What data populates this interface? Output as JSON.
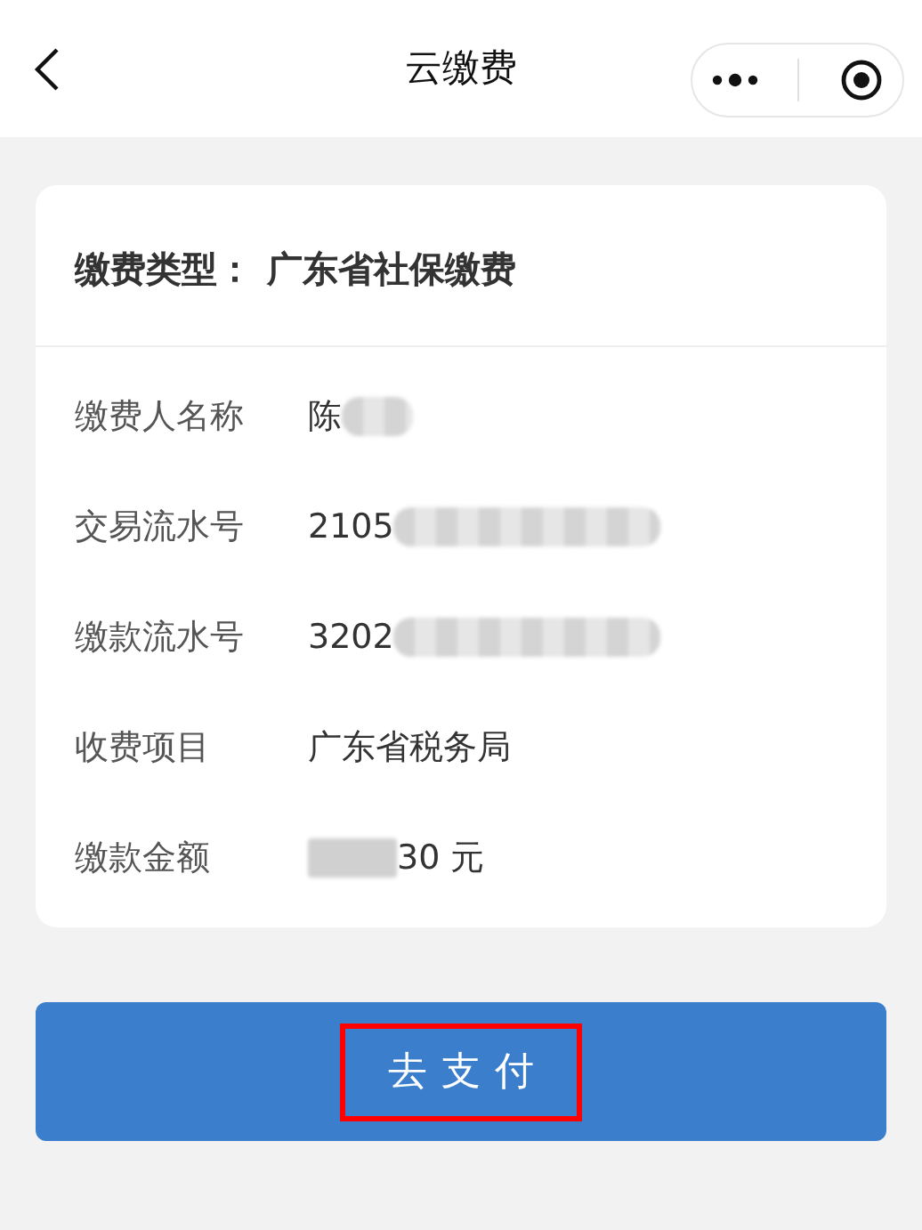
{
  "nav": {
    "title": "云缴费"
  },
  "card": {
    "title_label": "缴费类型：",
    "title_value": "广东省社保缴费",
    "rows": [
      {
        "label": "缴费人名称",
        "value": "陈",
        "blurred_after": true,
        "blurred_before": false
      },
      {
        "label": "交易流水号",
        "value": "2105",
        "blurred_after": true,
        "blurred_before": false
      },
      {
        "label": "缴款流水号",
        "value": "3202",
        "blurred_after": true,
        "blurred_before": false
      },
      {
        "label": "收费项目",
        "value": "广东省税务局",
        "blurred_after": false,
        "blurred_before": false
      },
      {
        "label": "缴款金额",
        "value": "30 元",
        "blurred_after": false,
        "blurred_before": true
      }
    ]
  },
  "button": {
    "label": "去支付",
    "highlighted": true
  }
}
